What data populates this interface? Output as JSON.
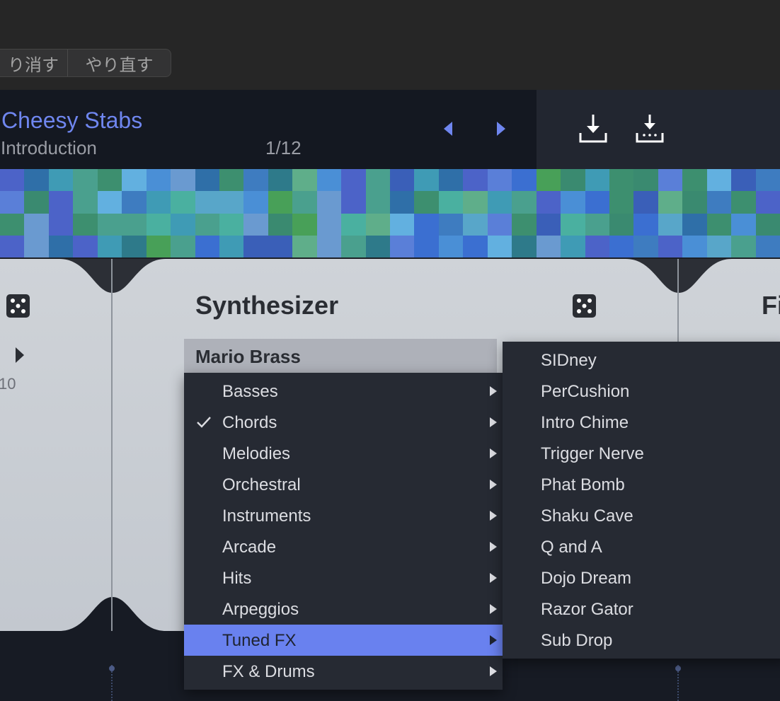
{
  "toolbar": {
    "undo_label": "り消す",
    "redo_label": "やり直す"
  },
  "header": {
    "title": "Cheesy Stabs",
    "subtitle": "Introduction",
    "page": "1/12",
    "accent": "#6f86ef"
  },
  "icons": {
    "prev": "left-triangle",
    "next": "right-triangle",
    "download": "download-tray",
    "download_all": "download-dotted-tray",
    "dice": "dice-five"
  },
  "panel": {
    "section_title": "Synthesizer",
    "next_section_title": "Fi",
    "side_number": "10",
    "preset_name": "Mario Brass"
  },
  "menu": {
    "categories": [
      {
        "label": "Basses",
        "checked": false,
        "highlighted": false
      },
      {
        "label": "Chords",
        "checked": true,
        "highlighted": false
      },
      {
        "label": "Melodies",
        "checked": false,
        "highlighted": false
      },
      {
        "label": "Orchestral",
        "checked": false,
        "highlighted": false
      },
      {
        "label": "Instruments",
        "checked": false,
        "highlighted": false
      },
      {
        "label": "Arcade",
        "checked": false,
        "highlighted": false
      },
      {
        "label": "Hits",
        "checked": false,
        "highlighted": false
      },
      {
        "label": "Arpeggios",
        "checked": false,
        "highlighted": false
      },
      {
        "label": "Tuned FX",
        "checked": false,
        "highlighted": true
      },
      {
        "label": "FX & Drums",
        "checked": false,
        "highlighted": false
      }
    ],
    "submenu": [
      "SIDney",
      "PerCushion",
      "Intro Chime",
      "Trigger Nerve",
      "Phat Bomb",
      "Shaku Cave",
      "Q and A",
      "Dojo Dream",
      "Razor Gator",
      "Sub Drop"
    ],
    "highlight_color": "#6981ef"
  }
}
